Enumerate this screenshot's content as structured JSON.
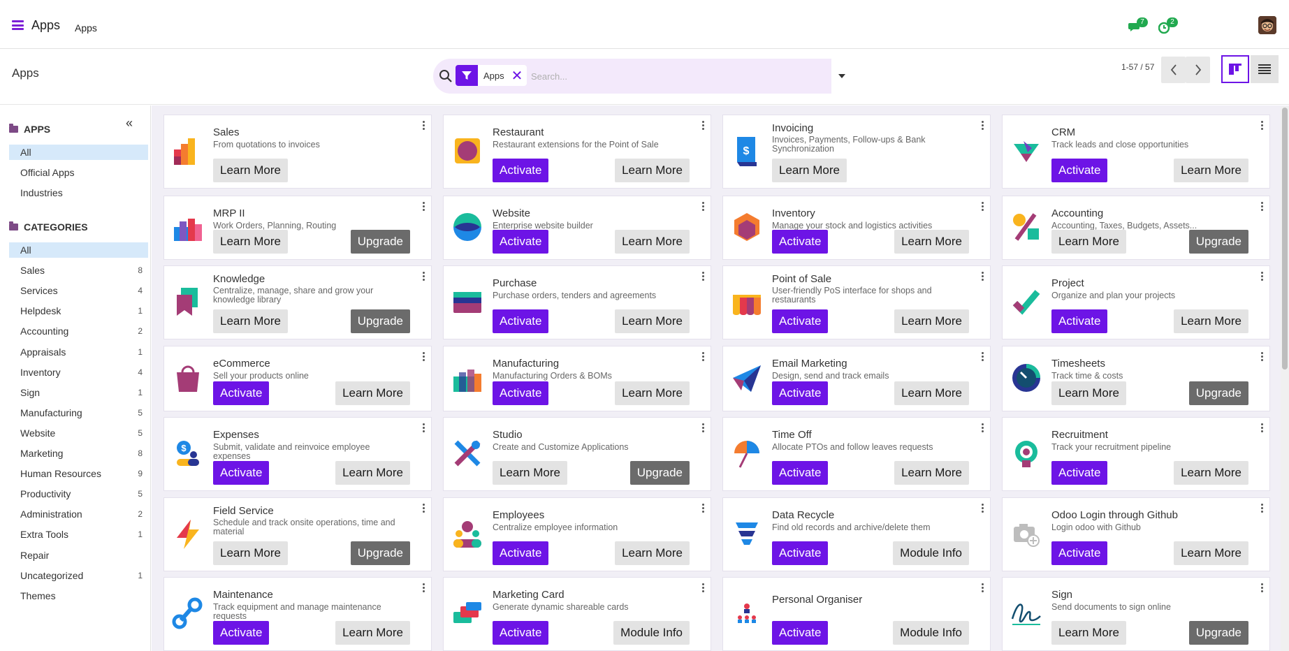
{
  "navbar": {
    "brand": "Apps",
    "menu": "Apps",
    "messages_count": "7",
    "activities_count": "2"
  },
  "control_panel": {
    "breadcrumb": "Apps",
    "facet_label": "Apps",
    "search_placeholder": "Search...",
    "pager": "1-57 / 57"
  },
  "sidebar": {
    "apps_heading": "APPS",
    "categories_heading": "CATEGORIES",
    "apps_items": [
      {
        "label": "All",
        "active": true
      },
      {
        "label": "Official Apps"
      },
      {
        "label": "Industries"
      }
    ],
    "category_items": [
      {
        "label": "All",
        "active": true,
        "count": ""
      },
      {
        "label": "Sales",
        "count": "8"
      },
      {
        "label": "Services",
        "count": "4"
      },
      {
        "label": "Helpdesk",
        "count": "1"
      },
      {
        "label": "Accounting",
        "count": "2"
      },
      {
        "label": "Appraisals",
        "count": "1"
      },
      {
        "label": "Inventory",
        "count": "4"
      },
      {
        "label": "Sign",
        "count": "1"
      },
      {
        "label": "Manufacturing",
        "count": "5"
      },
      {
        "label": "Website",
        "count": "5"
      },
      {
        "label": "Marketing",
        "count": "8"
      },
      {
        "label": "Human Resources",
        "count": "9"
      },
      {
        "label": "Productivity",
        "count": "5"
      },
      {
        "label": "Administration",
        "count": "2"
      },
      {
        "label": "Extra Tools",
        "count": "1"
      },
      {
        "label": "Repair",
        "count": ""
      },
      {
        "label": "Uncategorized",
        "count": "1"
      },
      {
        "label": "Themes",
        "count": ""
      }
    ]
  },
  "buttons": {
    "activate": "Activate",
    "learn_more": "Learn More",
    "upgrade": "Upgrade",
    "module_info": "Module Info"
  },
  "apps": [
    {
      "name": "Sales",
      "desc": "From quotations to invoices",
      "icon": "sales-icon",
      "buttons": [
        "learn_more"
      ]
    },
    {
      "name": "Restaurant",
      "desc": "Restaurant extensions for the Point of Sale",
      "icon": "restaurant-icon",
      "buttons": [
        "activate",
        "learn_more"
      ]
    },
    {
      "name": "Invoicing",
      "desc": "Invoices, Payments, Follow-ups & Bank Synchronization",
      "icon": "invoicing-icon",
      "buttons": [
        "learn_more"
      ]
    },
    {
      "name": "CRM",
      "desc": "Track leads and close opportunities",
      "icon": "crm-icon",
      "buttons": [
        "activate",
        "learn_more"
      ]
    },
    {
      "name": "MRP II",
      "desc": "Work Orders, Planning, Routing",
      "icon": "mrp-icon",
      "buttons": [
        "learn_more",
        "upgrade"
      ]
    },
    {
      "name": "Website",
      "desc": "Enterprise website builder",
      "icon": "website-icon",
      "buttons": [
        "activate",
        "learn_more"
      ]
    },
    {
      "name": "Inventory",
      "desc": "Manage your stock and logistics activities",
      "icon": "inventory-icon",
      "buttons": [
        "activate",
        "learn_more"
      ]
    },
    {
      "name": "Accounting",
      "desc": "Accounting, Taxes, Budgets, Assets...",
      "icon": "accounting-icon",
      "buttons": [
        "learn_more",
        "upgrade"
      ]
    },
    {
      "name": "Knowledge",
      "desc": "Centralize, manage, share and grow your knowledge library",
      "icon": "knowledge-icon",
      "buttons": [
        "learn_more",
        "upgrade"
      ]
    },
    {
      "name": "Purchase",
      "desc": "Purchase orders, tenders and agreements",
      "icon": "purchase-icon",
      "buttons": [
        "activate",
        "learn_more"
      ]
    },
    {
      "name": "Point of Sale",
      "desc": "User-friendly PoS interface for shops and restaurants",
      "icon": "point-of-sale-icon",
      "buttons": [
        "activate",
        "learn_more"
      ]
    },
    {
      "name": "Project",
      "desc": "Organize and plan your projects",
      "icon": "project-icon",
      "buttons": [
        "activate",
        "learn_more"
      ]
    },
    {
      "name": "eCommerce",
      "desc": "Sell your products online",
      "icon": "ecommerce-icon",
      "buttons": [
        "activate",
        "learn_more"
      ]
    },
    {
      "name": "Manufacturing",
      "desc": "Manufacturing Orders & BOMs",
      "icon": "manufacturing-icon",
      "buttons": [
        "activate",
        "learn_more"
      ]
    },
    {
      "name": "Email Marketing",
      "desc": "Design, send and track emails",
      "icon": "email-marketing-icon",
      "buttons": [
        "activate",
        "learn_more"
      ]
    },
    {
      "name": "Timesheets",
      "desc": "Track time & costs",
      "icon": "timesheets-icon",
      "buttons": [
        "learn_more",
        "upgrade"
      ]
    },
    {
      "name": "Expenses",
      "desc": "Submit, validate and reinvoice employee expenses",
      "icon": "expenses-icon",
      "buttons": [
        "activate",
        "learn_more"
      ]
    },
    {
      "name": "Studio",
      "desc": "Create and Customize Applications",
      "icon": "studio-icon",
      "buttons": [
        "learn_more",
        "upgrade"
      ]
    },
    {
      "name": "Time Off",
      "desc": "Allocate PTOs and follow leaves requests",
      "icon": "time-off-icon",
      "buttons": [
        "activate",
        "learn_more"
      ]
    },
    {
      "name": "Recruitment",
      "desc": "Track your recruitment pipeline",
      "icon": "recruitment-icon",
      "buttons": [
        "activate",
        "learn_more"
      ]
    },
    {
      "name": "Field Service",
      "desc": "Schedule and track onsite operations, time and material",
      "icon": "field-service-icon",
      "buttons": [
        "learn_more",
        "upgrade"
      ]
    },
    {
      "name": "Employees",
      "desc": "Centralize employee information",
      "icon": "employees-icon",
      "buttons": [
        "activate",
        "learn_more"
      ]
    },
    {
      "name": "Data Recycle",
      "desc": "Find old records and archive/delete them",
      "icon": "data-recycle-icon",
      "buttons": [
        "activate",
        "module_info"
      ]
    },
    {
      "name": "Odoo Login through Github",
      "desc": "Login odoo with Github",
      "icon": "camera-placeholder-icon",
      "buttons": [
        "activate",
        "learn_more"
      ]
    },
    {
      "name": "Maintenance",
      "desc": "Track equipment and manage maintenance requests",
      "icon": "maintenance-icon",
      "buttons": [
        "activate",
        "learn_more"
      ]
    },
    {
      "name": "Marketing Card",
      "desc": "Generate dynamic shareable cards",
      "icon": "marketing-card-icon",
      "buttons": [
        "activate",
        "module_info"
      ]
    },
    {
      "name": "Personal Organiser",
      "desc": "",
      "icon": "personal-organiser-icon",
      "buttons": [
        "activate",
        "module_info"
      ]
    },
    {
      "name": "Sign",
      "desc": "Send documents to sign online",
      "icon": "sign-icon",
      "buttons": [
        "learn_more",
        "upgrade"
      ]
    }
  ],
  "colors": {
    "primary": "#6d14e6",
    "secondary_btn": "#e3e3e3",
    "upgrade_btn": "#6b6b6b",
    "sidebar_active": "#d6e9fa",
    "search_bg": "#f3e9fb",
    "badge_green": "#21a94f"
  }
}
